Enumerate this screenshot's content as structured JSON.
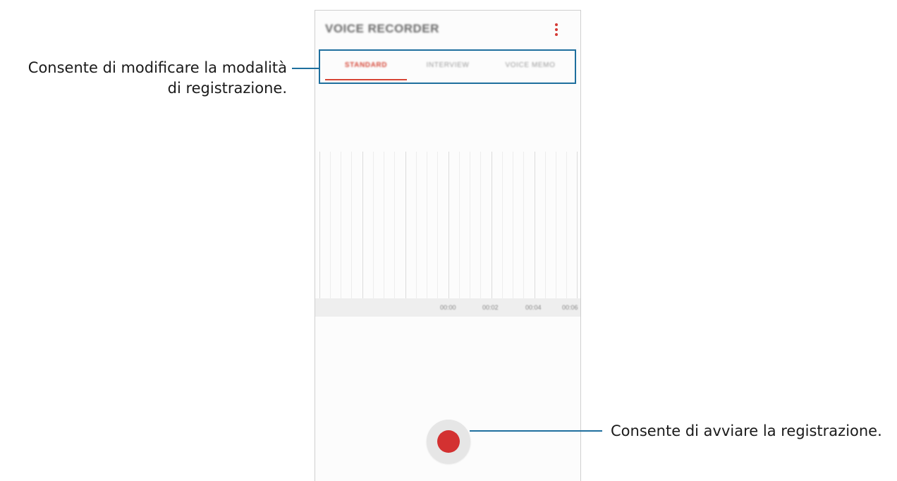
{
  "app": {
    "title": "VOICE RECORDER",
    "more_icon": "more-vert-icon"
  },
  "tabs": [
    {
      "label": "STANDARD",
      "active": true
    },
    {
      "label": "INTERVIEW",
      "active": false
    },
    {
      "label": "VOICE MEMO",
      "active": false
    }
  ],
  "timeline": {
    "labels": [
      "00:00",
      "00:02",
      "00:04",
      "00:06"
    ]
  },
  "record_button": {
    "icon": "record-icon"
  },
  "callouts": {
    "mode_line1": "Consente di modificare la modalità",
    "mode_line2": "di registrazione.",
    "record": "Consente di avviare la registrazione."
  },
  "colors": {
    "accent": "#d84535",
    "callout": "#1e6f9e",
    "record": "#d33131"
  }
}
